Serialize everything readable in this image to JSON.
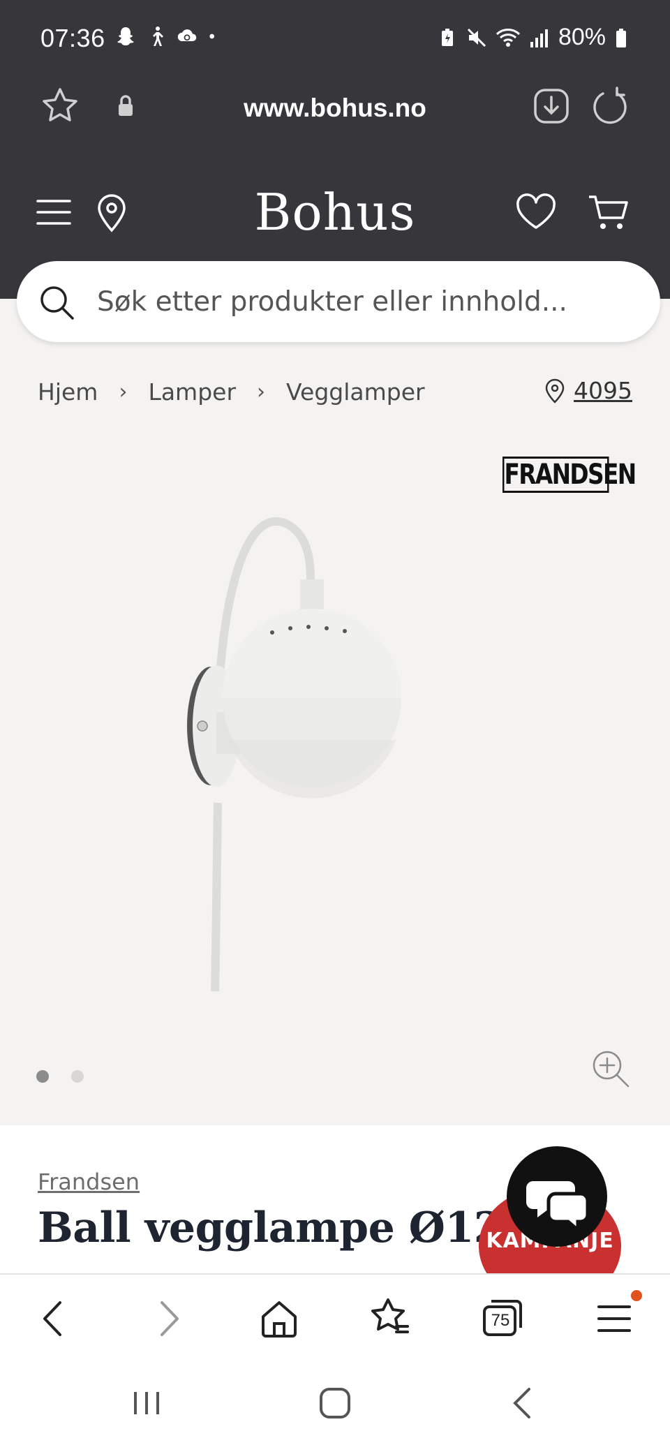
{
  "status_bar": {
    "time": "07:36",
    "battery": "80%",
    "left_icons": [
      "snapchat-icon",
      "walking-icon",
      "cloud-sync-icon",
      "dot-icon"
    ],
    "right_icons": [
      "battery-saver-icon",
      "mute-icon",
      "wifi-icon",
      "signal-icon",
      "battery-icon"
    ]
  },
  "browser": {
    "url": "www.bohus.no",
    "tab_count": "75"
  },
  "site": {
    "logo": "Bohus",
    "search_placeholder": "Søk etter produkter eller innhold..."
  },
  "breadcrumb": {
    "items": [
      "Hjem",
      "Lamper",
      "Vegglamper"
    ],
    "separator": "›",
    "store_code": "4095"
  },
  "product": {
    "brand_logo": "FRANDSEN",
    "brand": "Frandsen",
    "title": "Ball vegglampe Ø12",
    "badge": "KAMPANJE",
    "image_count": 2,
    "active_image": 1
  },
  "colors": {
    "header_bg": "#37363a",
    "page_bg": "#f4f3f1",
    "badge_red": "#c93030",
    "notification_orange": "#e0531f"
  }
}
